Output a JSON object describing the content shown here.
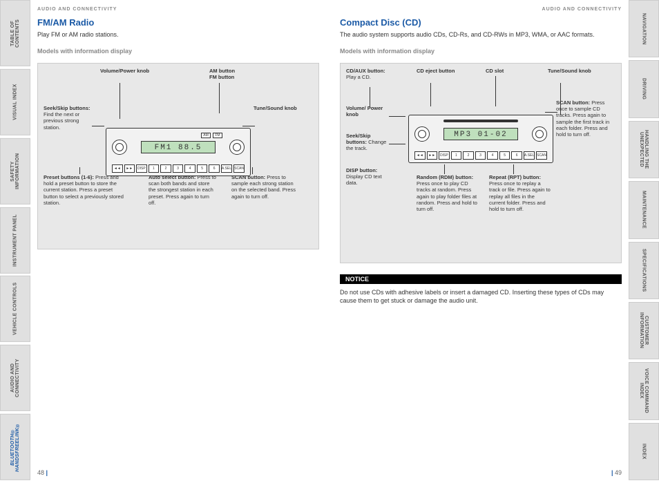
{
  "header": "AUDIO AND CONNECTIVITY",
  "left_tabs": [
    "TABLE OF CONTENTS",
    "VISUAL INDEX",
    "SAFETY INFORMATION",
    "INSTRUMENT PANEL",
    "VEHICLE CONTROLS",
    "AUDIO AND CONNECTIVITY",
    "BLUETOOTH® HANDSFREELINK®"
  ],
  "left_active_index": 6,
  "right_tabs": [
    "NAVIGATION",
    "DRIVING",
    "HANDLING THE UNEXPECTED",
    "MAINTENANCE",
    "SPECIFICATIONS",
    "CUSTOMER INFORMATION",
    "VOICE COMMAND INDEX",
    "INDEX"
  ],
  "page_left": {
    "title": "FM/AM Radio",
    "intro": "Play FM or AM radio stations.",
    "models": "Models with information display",
    "lcd": "FM1   88.5",
    "callouts": {
      "vol": {
        "label": "Volume/Power knob"
      },
      "am_fm": {
        "label": "AM button\nFM button"
      },
      "seek": {
        "label": "Seek/Skip buttons:",
        "desc": " Find the next or previous strong station."
      },
      "tune": {
        "label": "Tune/Sound knob"
      },
      "preset": {
        "label": "Preset buttons (1-6):",
        "desc": " Press and hold a preset button to store the current station. Press a preset button to select a previously stored station."
      },
      "auto": {
        "label": "Auto select button:",
        "desc": " Press to scan both bands and store the strongest station in each preset. Press again to turn off."
      },
      "scan": {
        "label": "SCAN button:",
        "desc": " Press to sample each strong station on the selected band. Press again to turn off."
      }
    },
    "num": "48"
  },
  "page_right": {
    "title": "Compact Disc (CD)",
    "intro": "The audio system supports audio CDs, CD-Rs, and CD-RWs in MP3, WMA, or AAC formats.",
    "models": "Models with information display",
    "lcd": "MP3  01-02",
    "callouts": {
      "cdaux": {
        "label": "CD/AUX button:",
        "desc": " Play a CD."
      },
      "eject": {
        "label": "CD eject button"
      },
      "slot": {
        "label": "CD slot"
      },
      "tune": {
        "label": "Tune/Sound knob"
      },
      "vol": {
        "label": "Volume/ Power knob"
      },
      "seek": {
        "label": "Seek/Skip buttons:",
        "desc": " Change the track."
      },
      "disp": {
        "label": "DISP button:",
        "desc": " Display CD text data."
      },
      "scan": {
        "label": "SCAN button:",
        "desc": " Press once to sample CD tracks. Press again to sample the first track in each folder. Press and hold to turn off."
      },
      "rdm": {
        "label": "Random (RDM) button:",
        "desc": " Press once to play CD tracks at random. Press again to play folder files at random. Press and hold to turn off."
      },
      "rpt": {
        "label": "Repeat (RPT) button:",
        "desc": " Press once to replay a track or file. Press again to replay all files in the current folder. Press and hold to turn off."
      }
    },
    "notice_label": "NOTICE",
    "notice_text": "Do not use CDs with adhesive labels or insert a damaged CD. Inserting these types of CDs may cause them to get stuck or damage the audio unit.",
    "num": "49"
  }
}
